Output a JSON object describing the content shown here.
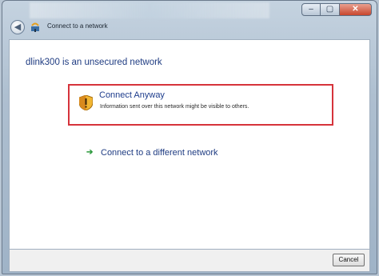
{
  "window": {
    "title": "Connect to a network",
    "caption": {
      "minimize": "–",
      "maximize": "▢",
      "close": "✕"
    }
  },
  "main": {
    "heading": "dlink300 is an unsecured network",
    "connect_anyway": {
      "title": "Connect Anyway",
      "description": "Information sent over this network might be visible to others."
    },
    "different_network": "Connect to a different network"
  },
  "footer": {
    "cancel_label": "Cancel"
  },
  "colors": {
    "link_text": "#1f3c82",
    "highlight_border": "#d6333b",
    "arrow_green": "#2e9a3e"
  }
}
